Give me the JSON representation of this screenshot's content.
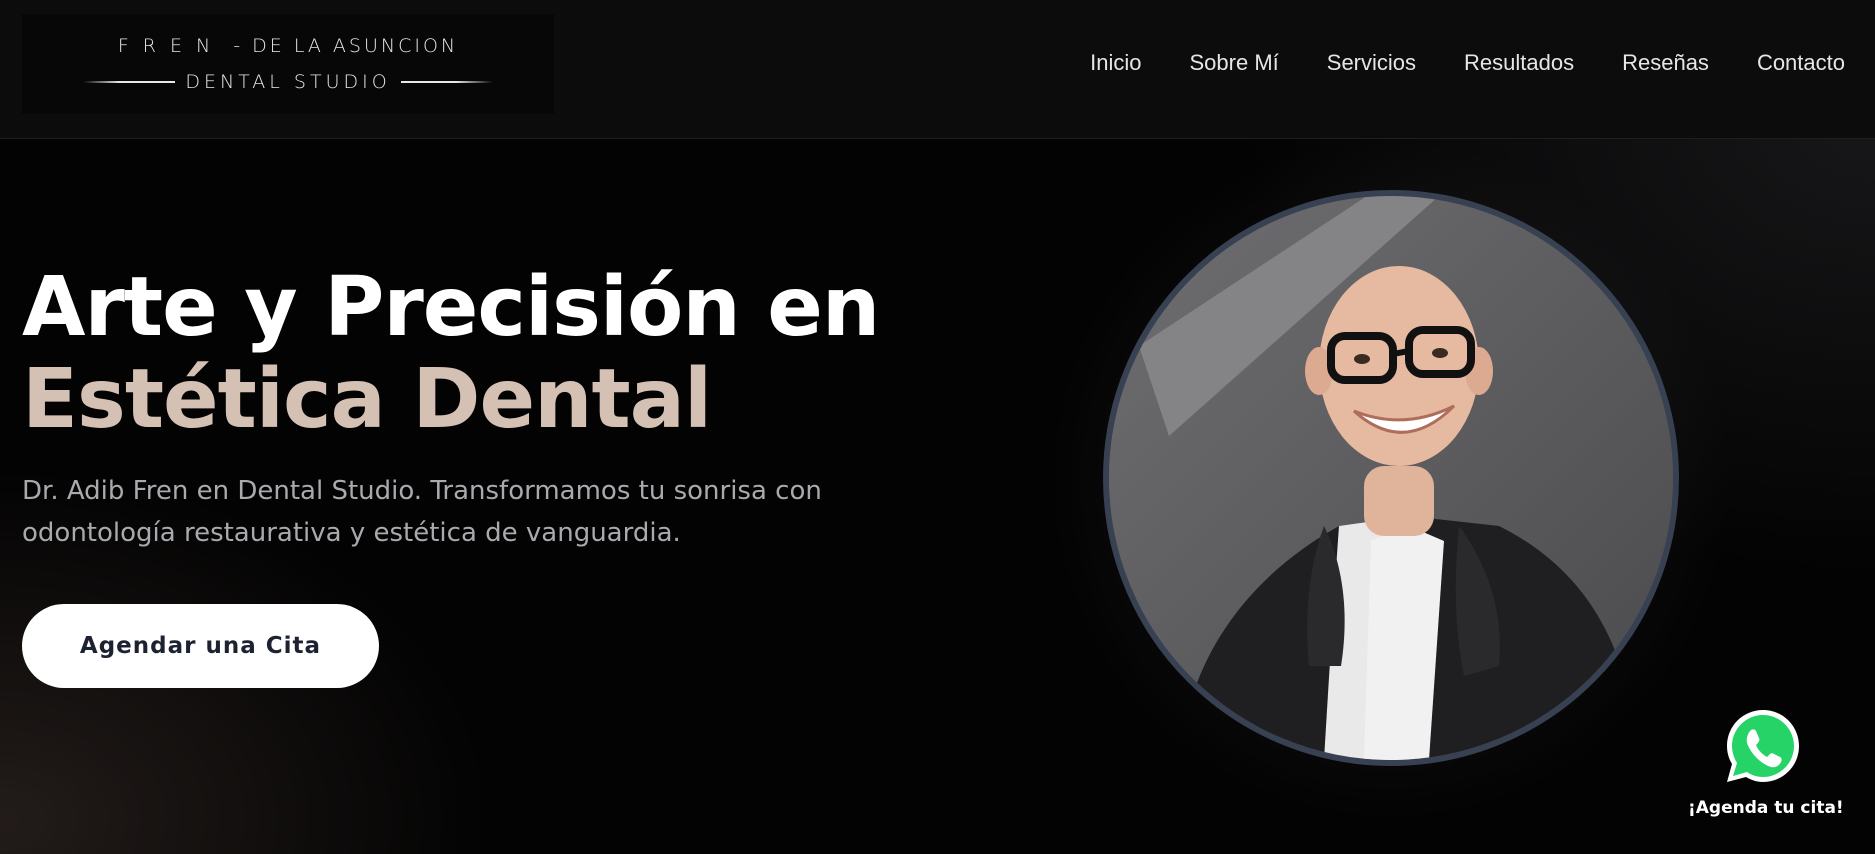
{
  "logo": {
    "top_spaced": "FREN",
    "top_rest": "- DE LA ASUNCION",
    "bottom": "DENTAL STUDIO"
  },
  "nav": {
    "items": [
      {
        "label": "Inicio"
      },
      {
        "label": "Sobre Mí"
      },
      {
        "label": "Servicios"
      },
      {
        "label": "Resultados"
      },
      {
        "label": "Reseñas"
      },
      {
        "label": "Contacto"
      }
    ]
  },
  "hero": {
    "title_line1": "Arte y Precisión en",
    "title_line2": "Estética Dental",
    "subtitle": "Dr. Adib Fren en Dental Studio. Transformamos tu sonrisa con odontología restaurativa y estética de vanguardia.",
    "cta_label": "Agendar una Cita"
  },
  "whatsapp": {
    "label": "¡Agenda tu cita!",
    "icon": "whatsapp-icon"
  },
  "colors": {
    "accent": "#d5c0b4",
    "cta_text": "#1c2230",
    "portrait_border": "#374152",
    "whatsapp_green": "#25d366"
  }
}
